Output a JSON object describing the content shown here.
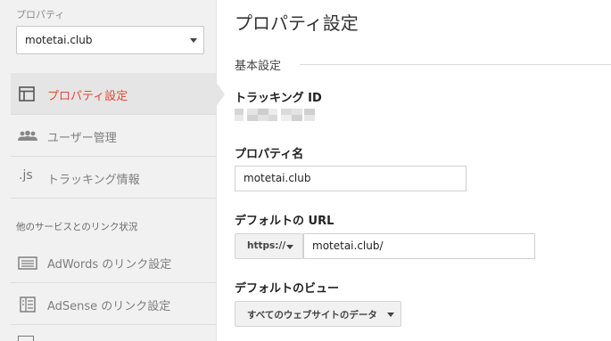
{
  "sidebar": {
    "property_label": "プロパティ",
    "property_select_value": "motetai.club",
    "nav_items": [
      {
        "label": "プロパティ設定",
        "icon": "layout-icon",
        "active": true
      },
      {
        "label": "ユーザー管理",
        "icon": "users-icon",
        "active": false
      },
      {
        "label": "トラッキング情報",
        "icon": "js-icon",
        "icon_text": ".js",
        "active": false
      }
    ],
    "links_section_title": "他のサービスとのリンク状況",
    "link_items": [
      {
        "label": "AdWords のリンク設定",
        "icon": "adwords-icon"
      },
      {
        "label": "AdSense のリンク設定",
        "icon": "adsense-icon"
      }
    ]
  },
  "main": {
    "title": "プロパティ設定",
    "basic_settings": "基本設定",
    "tracking_id_label": "トラッキング ID",
    "property_name_label": "プロパティ名",
    "property_name_value": "motetai.club",
    "default_url_label": "デフォルトの URL",
    "protocol_value": "https://",
    "default_url_value": "motetai.club/",
    "default_view_label": "デフォルトのビュー",
    "default_view_value": "すべてのウェブサイトのデータ"
  },
  "colors": {
    "active_text": "#dd4b39",
    "sidebar_bg": "#f1f1f1",
    "active_bg": "#e5e5e5"
  }
}
